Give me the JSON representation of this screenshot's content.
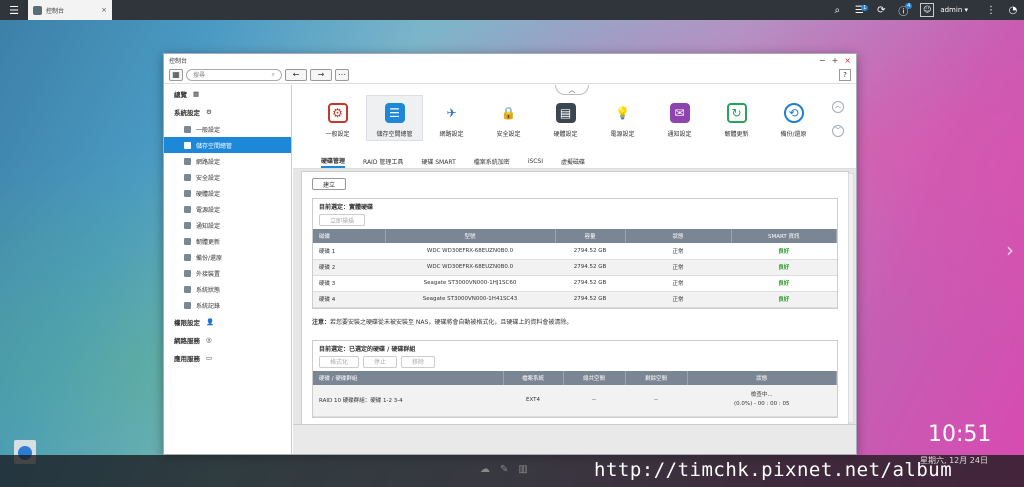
{
  "topbar": {
    "tab_label": "控制台",
    "tab_close": "×",
    "badges": {
      "notify": "1",
      "info": "4"
    },
    "user": "admin ▾"
  },
  "window": {
    "title": "控制台",
    "search_placeholder": "搜尋",
    "controls": {
      "min": "−",
      "max": "+",
      "close": "×"
    },
    "help": "?"
  },
  "sidebar": {
    "overview": "總覽",
    "system_settings": "系統設定",
    "items": [
      {
        "label": "一般設定"
      },
      {
        "label": "儲存空間總管"
      },
      {
        "label": "網路設定"
      },
      {
        "label": "安全設定"
      },
      {
        "label": "硬體設定"
      },
      {
        "label": "電源設定"
      },
      {
        "label": "通知設定"
      },
      {
        "label": "韌體更新"
      },
      {
        "label": "備份/還原"
      },
      {
        "label": "外接裝置"
      },
      {
        "label": "系統狀態"
      },
      {
        "label": "系統記錄"
      }
    ],
    "privilege": "權限設定",
    "network_services": "網路服務",
    "applications": "應用服務"
  },
  "icons": [
    {
      "label": "一般設定",
      "color": "#c0392b"
    },
    {
      "label": "儲存空間總管",
      "color": "#1e88d8"
    },
    {
      "label": "網路設定",
      "color": "#2a6fc9"
    },
    {
      "label": "安全設定",
      "color": "#555555"
    },
    {
      "label": "硬體設定",
      "color": "#3b4652"
    },
    {
      "label": "電源設定",
      "color": "#2bb39a"
    },
    {
      "label": "通知設定",
      "color": "#8e44ad"
    },
    {
      "label": "韌體更新",
      "color": "#27a35b"
    },
    {
      "label": "備份/還原",
      "color": "#1f7fd0"
    }
  ],
  "tabs": [
    "硬碟管理",
    "RAID 管理工具",
    "硬碟 SMART",
    "檔案系統加密",
    "iSCSI",
    "虛擬磁碟"
  ],
  "panel": {
    "create_button": "建立",
    "current_1": "目前選定：實體硬碟",
    "scan_button": "立即掃描",
    "disk_headers": [
      "磁碟",
      "型號",
      "容量",
      "狀態",
      "SMART 資訊"
    ],
    "disks": [
      {
        "disk": "硬碟 1",
        "model": "WDC WD30EFRX-68EUZN0B0.0",
        "capacity": "2794.52 GB",
        "status": "正常",
        "smart": "良好"
      },
      {
        "disk": "硬碟 2",
        "model": "WDC WD30EFRX-68EUZN0B0.0",
        "capacity": "2794.52 GB",
        "status": "正常",
        "smart": "良好"
      },
      {
        "disk": "硬碟 3",
        "model": "Seagate ST3000VN000-1HJ1SC60",
        "capacity": "2794.52 GB",
        "status": "正常",
        "smart": "良好"
      },
      {
        "disk": "硬碟 4",
        "model": "Seagate ST3000VN000-1H41SC43",
        "capacity": "2794.52 GB",
        "status": "正常",
        "smart": "良好"
      }
    ],
    "note_prefix": "注意：",
    "note": "若您要安裝之硬碟從未被安裝至 NAS，硬碟將會自動被格式化，且硬碟上的資料會被清除。",
    "current_2": "目前選定：已選定的硬碟 / 硬碟群組",
    "group_buttons": [
      "格式化",
      "停止",
      "移除"
    ],
    "group_headers": [
      "硬碟 / 硬碟群組",
      "檔案系統",
      "總共空間",
      "剩餘空間",
      "狀態"
    ],
    "group_row": {
      "name": "RAID 10 硬碟群組：硬碟 1-2 3-4",
      "fs": "EXT4",
      "total": "--",
      "free": "--",
      "status1": "檢查中...",
      "status2": "(0.0%) - 00 : 00 : 05"
    }
  },
  "desktop": {
    "clock": "10:51",
    "date": "星期六, 12月 24日",
    "watermark": "http://timchk.pixnet.net/album"
  }
}
